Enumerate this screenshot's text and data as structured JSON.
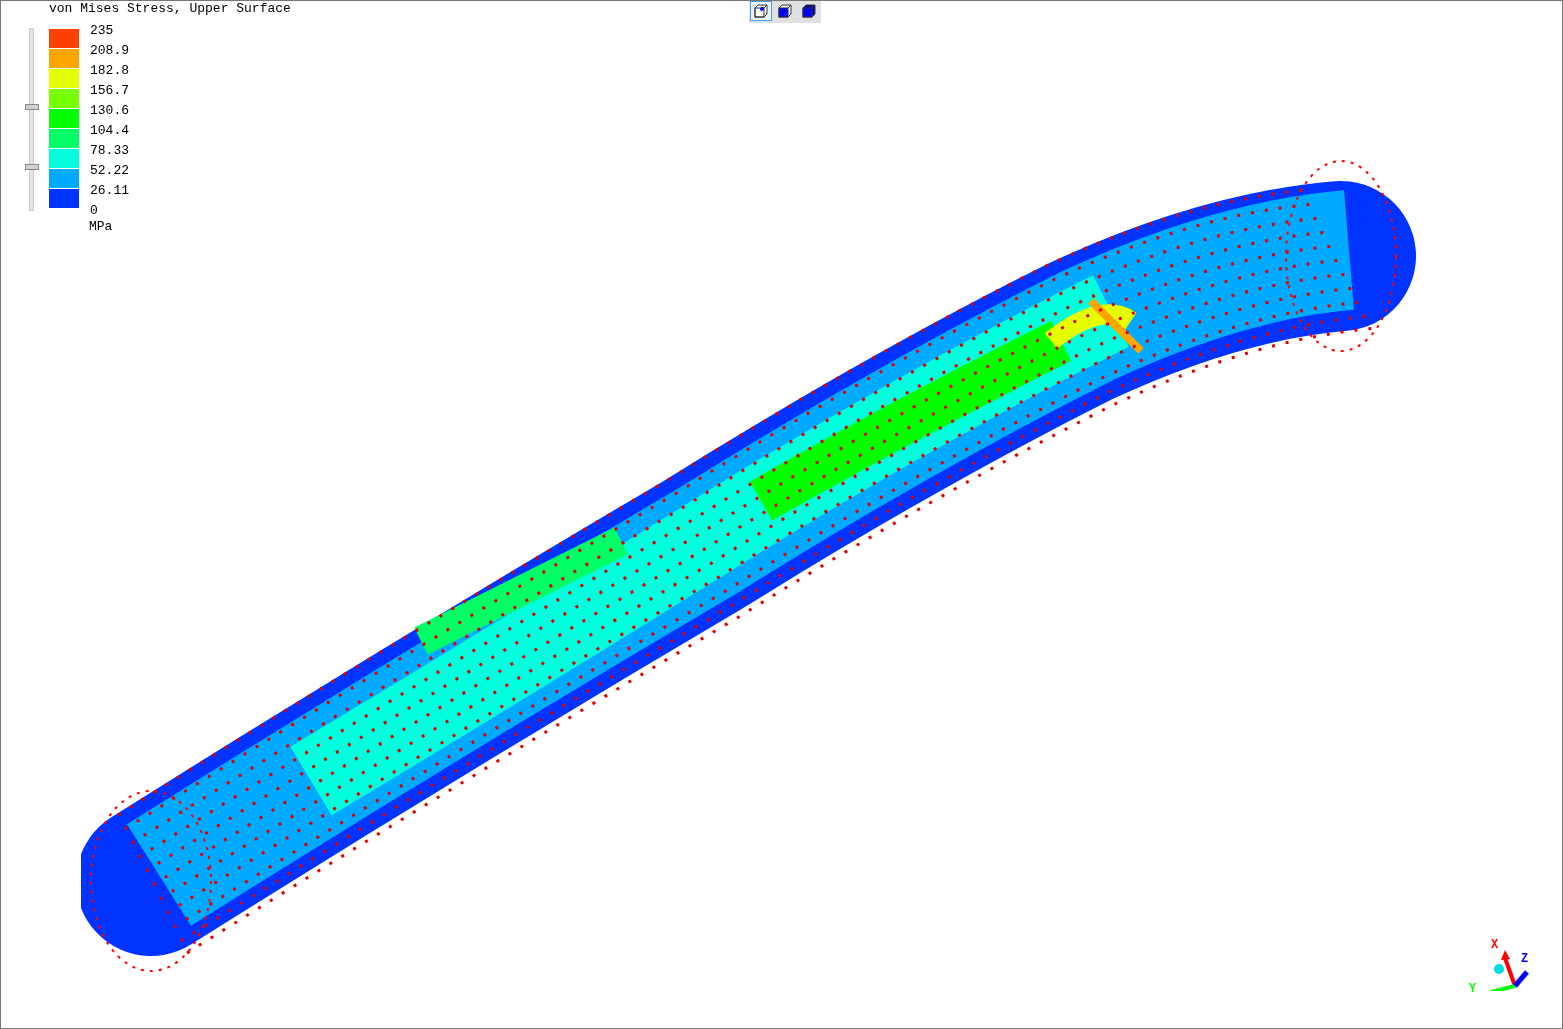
{
  "legend": {
    "title": "von Mises Stress, Upper Surface",
    "unit": "MPa",
    "labels": [
      "235",
      "208.9",
      "182.8",
      "156.7",
      "130.6",
      "104.4",
      "78.33",
      "52.22",
      "26.11",
      "0"
    ],
    "swatches": [
      {
        "color": "#ff4000"
      },
      {
        "color": "#ffa500"
      },
      {
        "color": "#e5ff00"
      },
      {
        "color": "#77ff00"
      },
      {
        "color": "#00ff00"
      },
      {
        "color": "#00ff66"
      },
      {
        "color": "#00ffdd"
      },
      {
        "color": "#00aaff"
      },
      {
        "color": "#0033ff"
      }
    ],
    "slider_thumbs": [
      {
        "level": 0.57
      },
      {
        "level": 0.24
      }
    ]
  },
  "toolbar": {
    "buttons": [
      {
        "kind": "wireframe",
        "selected": true
      },
      {
        "kind": "shaded-edges",
        "selected": false
      },
      {
        "kind": "shaded",
        "selected": false
      }
    ]
  },
  "axes": [
    {
      "label": "X",
      "color": "#ff0000"
    },
    {
      "label": "Y",
      "color": "#00ff00"
    },
    {
      "label": "Z",
      "color": "#0000ff"
    }
  ]
}
